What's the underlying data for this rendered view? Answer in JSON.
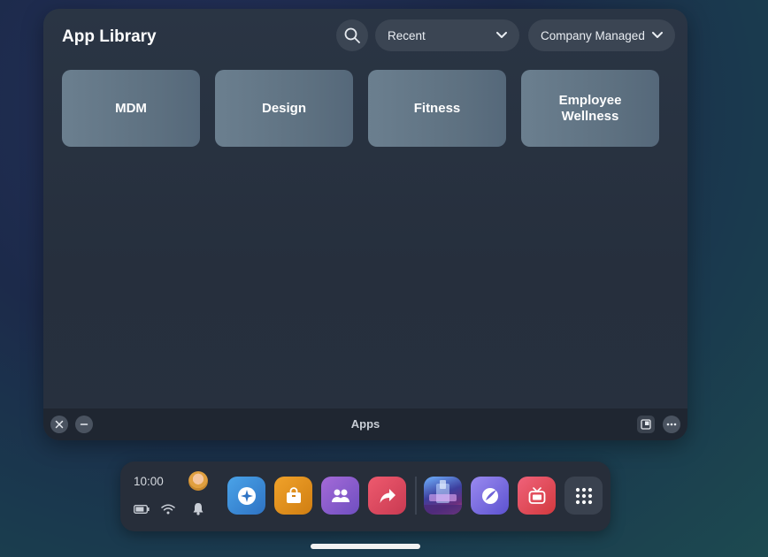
{
  "window": {
    "title": "App Library",
    "search_icon": "search-icon",
    "filters": {
      "sort": {
        "selected": "Recent",
        "icon": "chevron-down-icon"
      },
      "source": {
        "selected": "Company Managed",
        "icon": "chevron-down-icon"
      }
    },
    "categories": [
      "MDM",
      "Design",
      "Fitness",
      "Employee Wellness"
    ],
    "bar": {
      "label": "Apps",
      "left_icons": [
        "close-icon",
        "minimize-icon"
      ],
      "right_icons": [
        "resize-icon",
        "more-icon"
      ]
    }
  },
  "dock": {
    "time": "10:00",
    "status_icons": [
      "battery-icon",
      "wifi-icon",
      "bell-icon"
    ],
    "apps": [
      {
        "icon": "explore-icon",
        "color": "#3d8fd8"
      },
      {
        "icon": "store-bag-icon",
        "color": "#e0901e"
      },
      {
        "icon": "people-icon",
        "color": "#8b5fc8"
      },
      {
        "icon": "share-icon",
        "color": "#d8455e"
      },
      {
        "icon": "game-thumbnail-icon",
        "color": "#5a6fd0"
      },
      {
        "icon": "browser-icon",
        "color": "#7b66e0"
      },
      {
        "icon": "tv-icon",
        "color": "#e04a52"
      },
      {
        "icon": "app-grid-icon",
        "color": "#3a424f"
      }
    ]
  },
  "colors": {
    "window_bg": "#2a3544",
    "tile_bg": "#6b7f8f",
    "dock_bg": "#272e3a"
  }
}
